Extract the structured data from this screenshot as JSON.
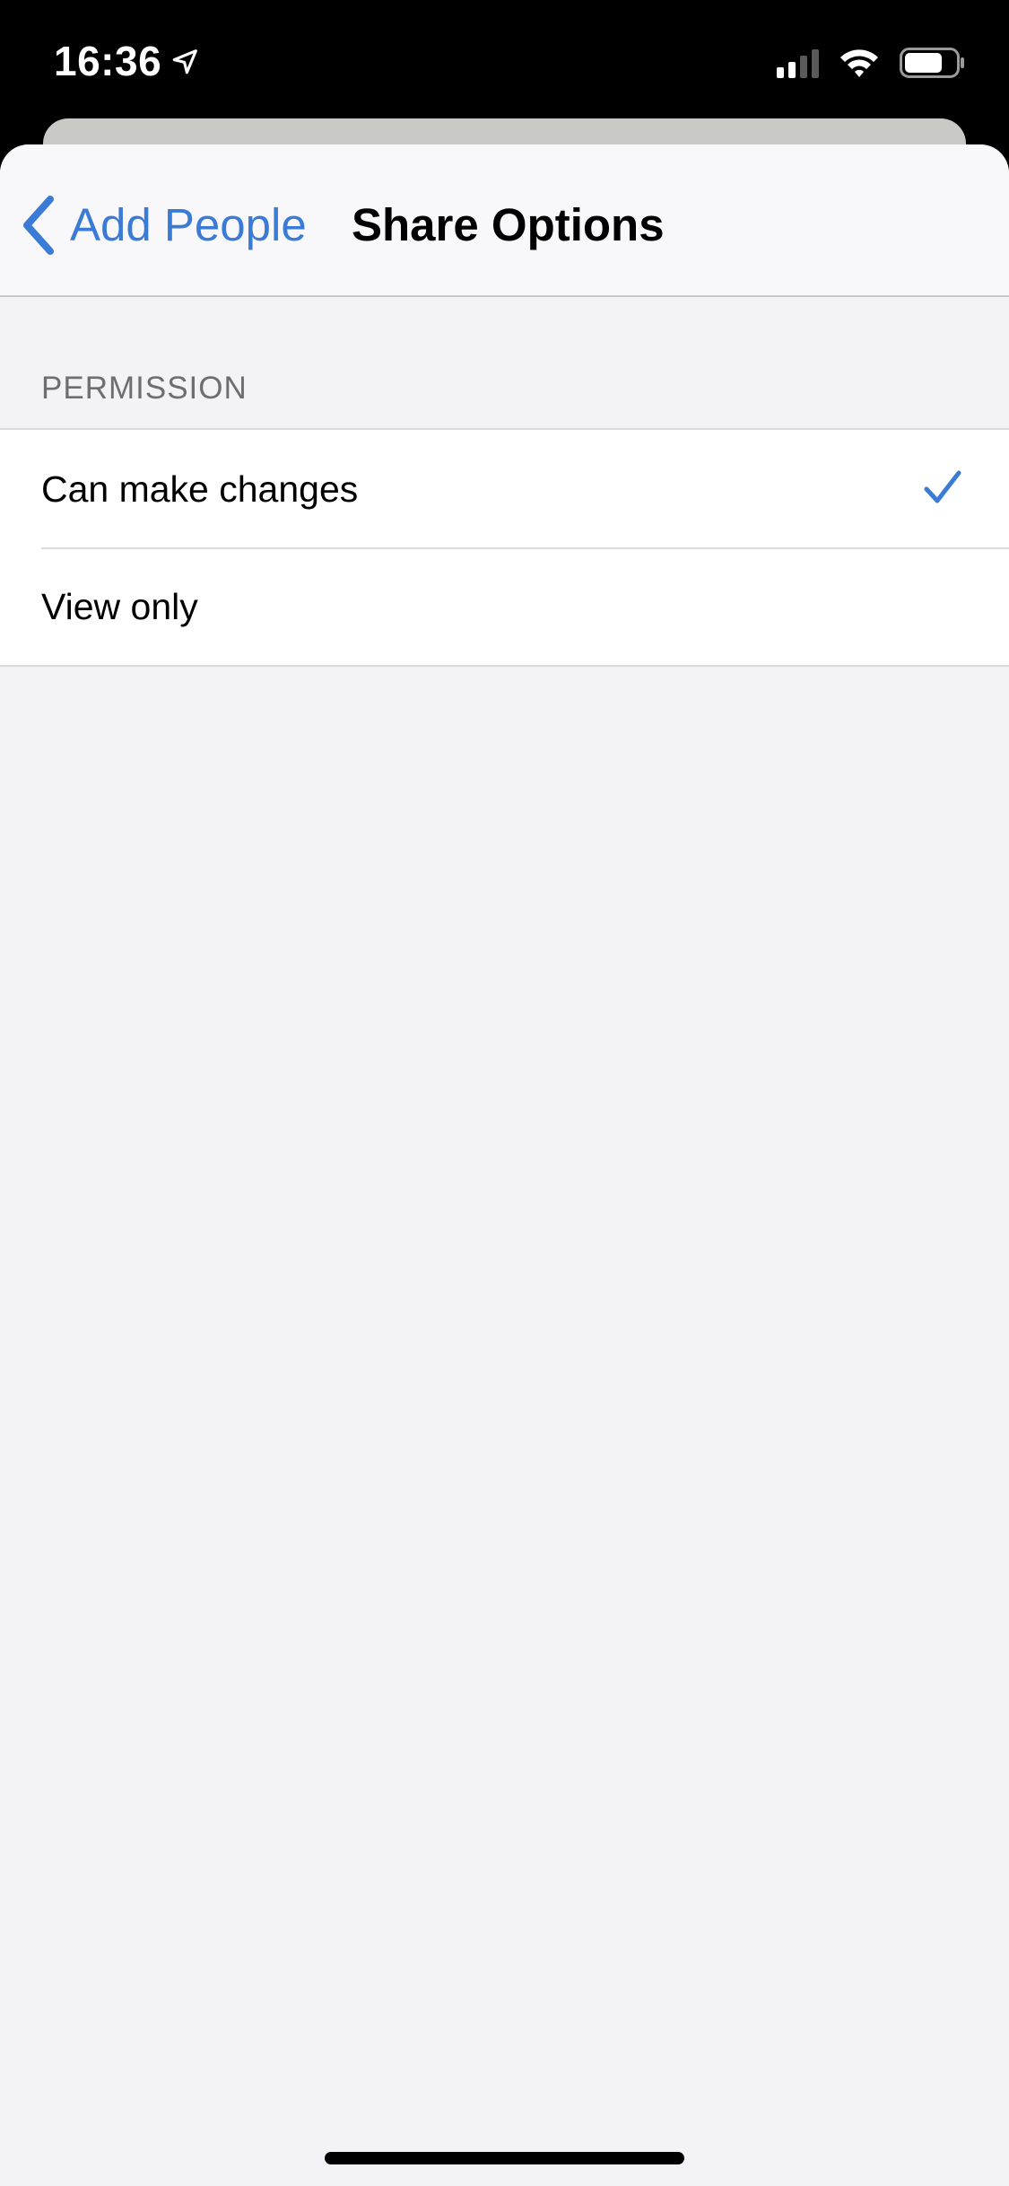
{
  "status_bar": {
    "time": "16:36",
    "icons": [
      "location-arrow-icon",
      "cellular-signal-icon",
      "wifi-icon",
      "battery-icon"
    ],
    "signal_bars_active": 2,
    "signal_bars_total": 4
  },
  "nav": {
    "back_label": "Add People",
    "back_icon": "chevron-left-icon",
    "title": "Share Options"
  },
  "permission_section": {
    "header": "PERMISSION",
    "options": [
      {
        "label": "Can make changes",
        "selected": true
      },
      {
        "label": "View only",
        "selected": false
      }
    ]
  },
  "colors": {
    "accent": "#3a7bd5",
    "background": "#f2f2f7",
    "status_bar_bg": "#000000",
    "card_bg": "#ffffff",
    "section_header": "#6d6d72"
  }
}
